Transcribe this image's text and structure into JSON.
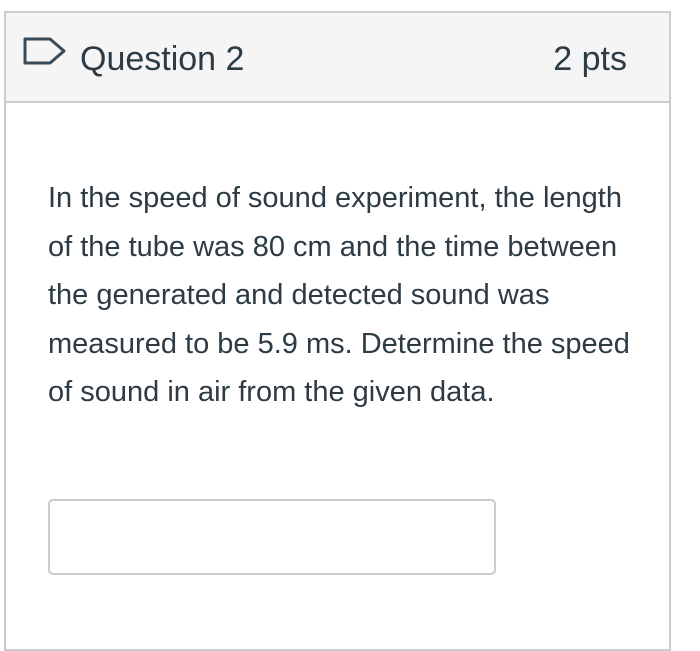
{
  "question": {
    "title": "Question 2",
    "points": "2 pts",
    "flag_icon": "bookmark-flag-icon",
    "text": "In the speed of sound experiment, the length of the tube was 80 cm and the time between the generated and detected sound was measured to be 5.9 ms. Determine the speed of sound in air from the given data."
  },
  "answer": {
    "value": "",
    "placeholder": ""
  },
  "colors": {
    "text": "#2d3b45",
    "border": "#c7cdd1",
    "header_background": "#f5f5f5",
    "flag_stroke": "#394b58"
  }
}
